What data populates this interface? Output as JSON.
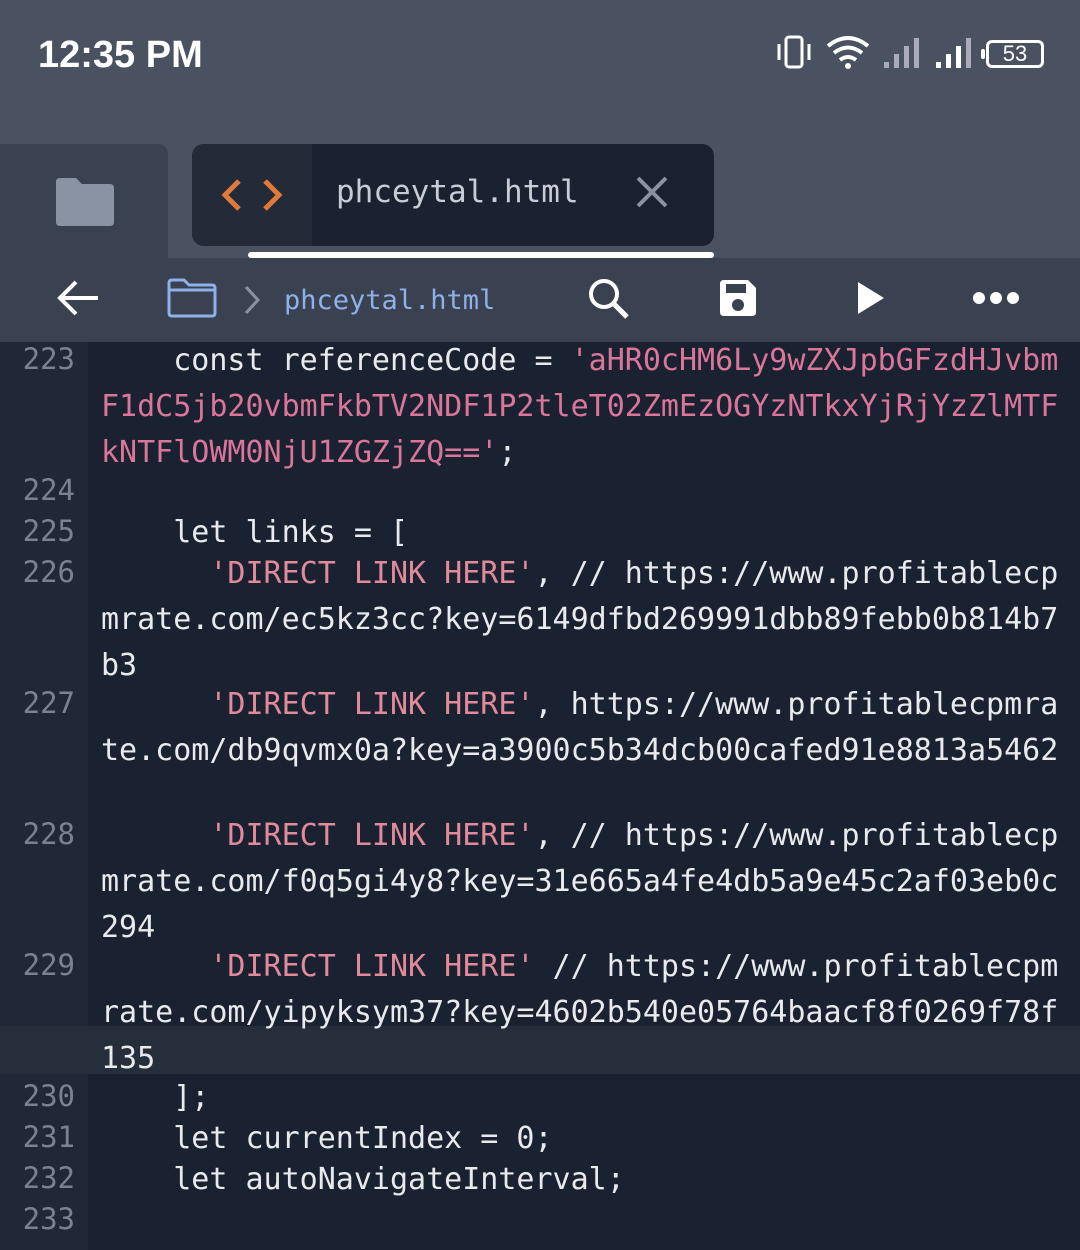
{
  "status_bar": {
    "time": "12:35 PM",
    "battery": "53"
  },
  "tabs": {
    "active_file": "phceytal.html"
  },
  "toolbar": {
    "breadcrumb_file": "phceytal.html"
  },
  "code_lines": [
    {
      "number": "223",
      "indent": "    ",
      "text": "const referenceCode = ",
      "string": "'aHR0cHM6Ly9wZXJpbGFzdHJvbmF1dC5jb20vbmFkbTV2NDF1P2tleT02ZmEzOGYzNTkxYjRjYzZlMTFkNTFlOWM0NjU1ZGZjZQ=='",
      "after": ";"
    },
    {
      "number": "224",
      "text": ""
    },
    {
      "number": "225",
      "indent": "    ",
      "text": "let links = ["
    },
    {
      "number": "226",
      "indent": "      ",
      "string": "'DIRECT LINK HERE'",
      "after": ", // https://www.profitablecpmrate.com/ec5kz3cc?key=6149dfbd269991dbb89febb0b814b7b3"
    },
    {
      "number": "227",
      "indent": "      ",
      "string": "'DIRECT LINK HERE'",
      "after": ", https://www.profitablecpmrate.com/db9qvmx0a?key=a3900c5b34dcb00cafed91e8813a5462"
    },
    {
      "number": "228",
      "indent": "      ",
      "string": "'DIRECT LINK HERE'",
      "after": ", // https://www.profitablecpmrate.com/f0q5gi4y8?key=31e665a4fe4db5a9e45c2af03eb0c294"
    },
    {
      "number": "229",
      "indent": "      ",
      "string": "'DIRECT LINK HERE'",
      "after": " // https://www.profitablecpmrate.com/yipyksym37?key=4602b540e05764baacf8f0269f78f135"
    },
    {
      "number": "230",
      "indent": "    ",
      "text": "];"
    },
    {
      "number": "231",
      "indent": "    ",
      "text": "let currentIndex = 0;"
    },
    {
      "number": "232",
      "indent": "    ",
      "text": "let autoNavigateInterval;"
    },
    {
      "number": "233",
      "text": ""
    }
  ],
  "colors": {
    "string": "#d9769a",
    "accent_code_icon": "#e07a3a",
    "breadcrumb": "#8fb0e8"
  },
  "icons": [
    "vibrate-icon",
    "wifi-icon",
    "signal-icon",
    "battery-icon",
    "folder-icon",
    "code-icon",
    "close-icon",
    "back-arrow-icon",
    "folder-outline-icon",
    "chevron-right-icon",
    "search-icon",
    "save-icon",
    "play-icon",
    "more-icon"
  ]
}
